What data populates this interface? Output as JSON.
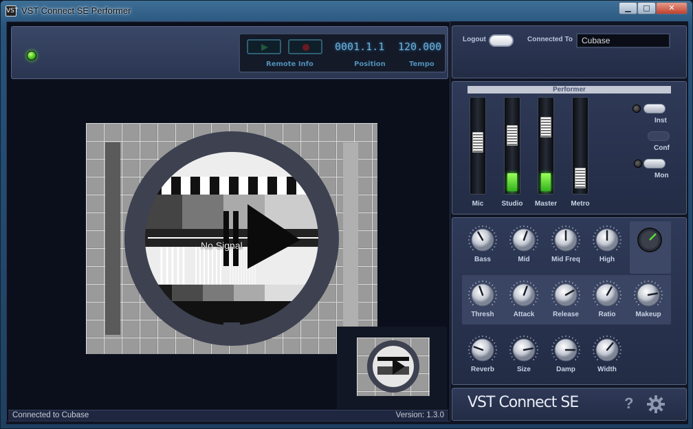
{
  "window": {
    "title": "VST Connect SE Performer",
    "minimize": "▁",
    "maximize": "□",
    "close": "✕",
    "app_icon": "VST"
  },
  "transport": {
    "position": "0001.1.1",
    "tempo": "120.000",
    "labels": {
      "remote_info": "Remote Info",
      "position": "Position",
      "tempo": "Tempo"
    },
    "play_icon": "play-icon",
    "record_icon": "record-icon"
  },
  "video": {
    "overlay_text": "No Signal"
  },
  "status": {
    "text": "Connected to Cubase",
    "version": "Version: 1.3.0"
  },
  "login": {
    "logout_label": "Logout",
    "connected_to_label": "Connected To",
    "connected_to_value": "Cubase"
  },
  "performer": {
    "header": "Performer",
    "faders": [
      {
        "label": "Mic",
        "level": 0.0
      },
      {
        "label": "Studio",
        "level": 0.2
      },
      {
        "label": "Master",
        "level": 0.2
      },
      {
        "label": "Metro",
        "level": 0.0
      }
    ],
    "toggles": [
      {
        "label": "Inst"
      },
      {
        "label": "Conf"
      },
      {
        "label": "Mon"
      }
    ]
  },
  "effects": {
    "eq": [
      {
        "label": "Bass"
      },
      {
        "label": "Mid"
      },
      {
        "label": "Mid Freq"
      },
      {
        "label": "High"
      }
    ],
    "dyn": [
      {
        "label": "Thresh"
      },
      {
        "label": "Attack"
      },
      {
        "label": "Release"
      },
      {
        "label": "Ratio"
      },
      {
        "label": "Makeup"
      }
    ],
    "reverb": [
      {
        "label": "Reverb"
      },
      {
        "label": "Size"
      },
      {
        "label": "Damp"
      },
      {
        "label": "Width"
      }
    ],
    "scale_min": "10",
    "scale_max": "10"
  },
  "brand": {
    "name": "VST Connect SE",
    "help": "?",
    "gear_icon": "gear-icon"
  },
  "colors": {
    "accent_green": "#4ce82a",
    "lcd_blue": "#6fb0d8",
    "panel": "#2f3a58"
  }
}
